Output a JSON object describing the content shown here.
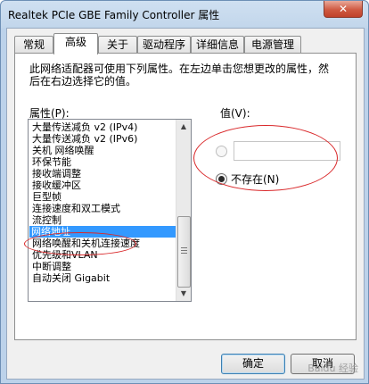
{
  "window": {
    "title": "Realtek PCIe GBE Family Controller 属性",
    "close_symbol": "✕"
  },
  "tabs": [
    {
      "label": "常规"
    },
    {
      "label": "高级"
    },
    {
      "label": "关于"
    },
    {
      "label": "驱动程序"
    },
    {
      "label": "详细信息"
    },
    {
      "label": "电源管理"
    }
  ],
  "panel": {
    "description": "此网络适配器可使用下列属性。在左边单击您想更改的属性，然后在右边选择它的值。",
    "property_label": "属性(P):",
    "value_label": "值(V):",
    "properties": [
      "大量传送减负 v2 (IPv4)",
      "大量传送减负 v2 (IPv6)",
      "关机 网络唤醒",
      "环保节能",
      "接收端调整",
      "接收缓冲区",
      "巨型帧",
      "连接速度和双工模式",
      "流控制",
      "网络地址",
      "网络唤醒和关机连接速度",
      "优先级和VLAN",
      "中断调整",
      "自动关闭 Gigabit"
    ],
    "selected_property": "网络地址",
    "value_input": "",
    "not_present_label": "不存在(N)"
  },
  "buttons": {
    "ok": "确定",
    "cancel": "取消"
  },
  "watermark": "Baidu 经验"
}
